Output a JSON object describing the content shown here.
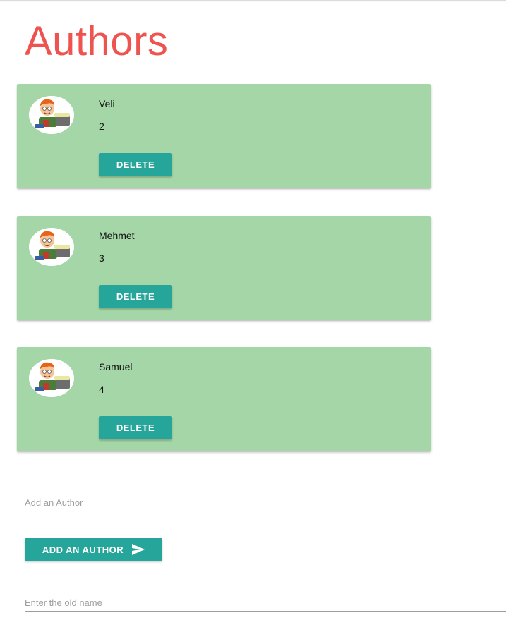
{
  "page": {
    "title": "Authors",
    "title_color": "#ef5350",
    "accent_color": "#26a69a",
    "card_color": "#a5d6a7"
  },
  "authors": [
    {
      "name": "Veli",
      "value": "2",
      "delete_label": "DELETE",
      "avatar_icon": "cartoon-boy-avatar-icon"
    },
    {
      "name": "Mehmet",
      "value": "3",
      "delete_label": "DELETE",
      "avatar_icon": "cartoon-boy-avatar-icon"
    },
    {
      "name": "Samuel",
      "value": "4",
      "delete_label": "DELETE",
      "avatar_icon": "cartoon-boy-avatar-icon"
    }
  ],
  "add_author": {
    "placeholder": "Add an Author",
    "value": "",
    "button_label": "ADD AN AUTHOR",
    "button_icon": "send-icon"
  },
  "rename": {
    "placeholder": "Enter the old name",
    "value": ""
  }
}
